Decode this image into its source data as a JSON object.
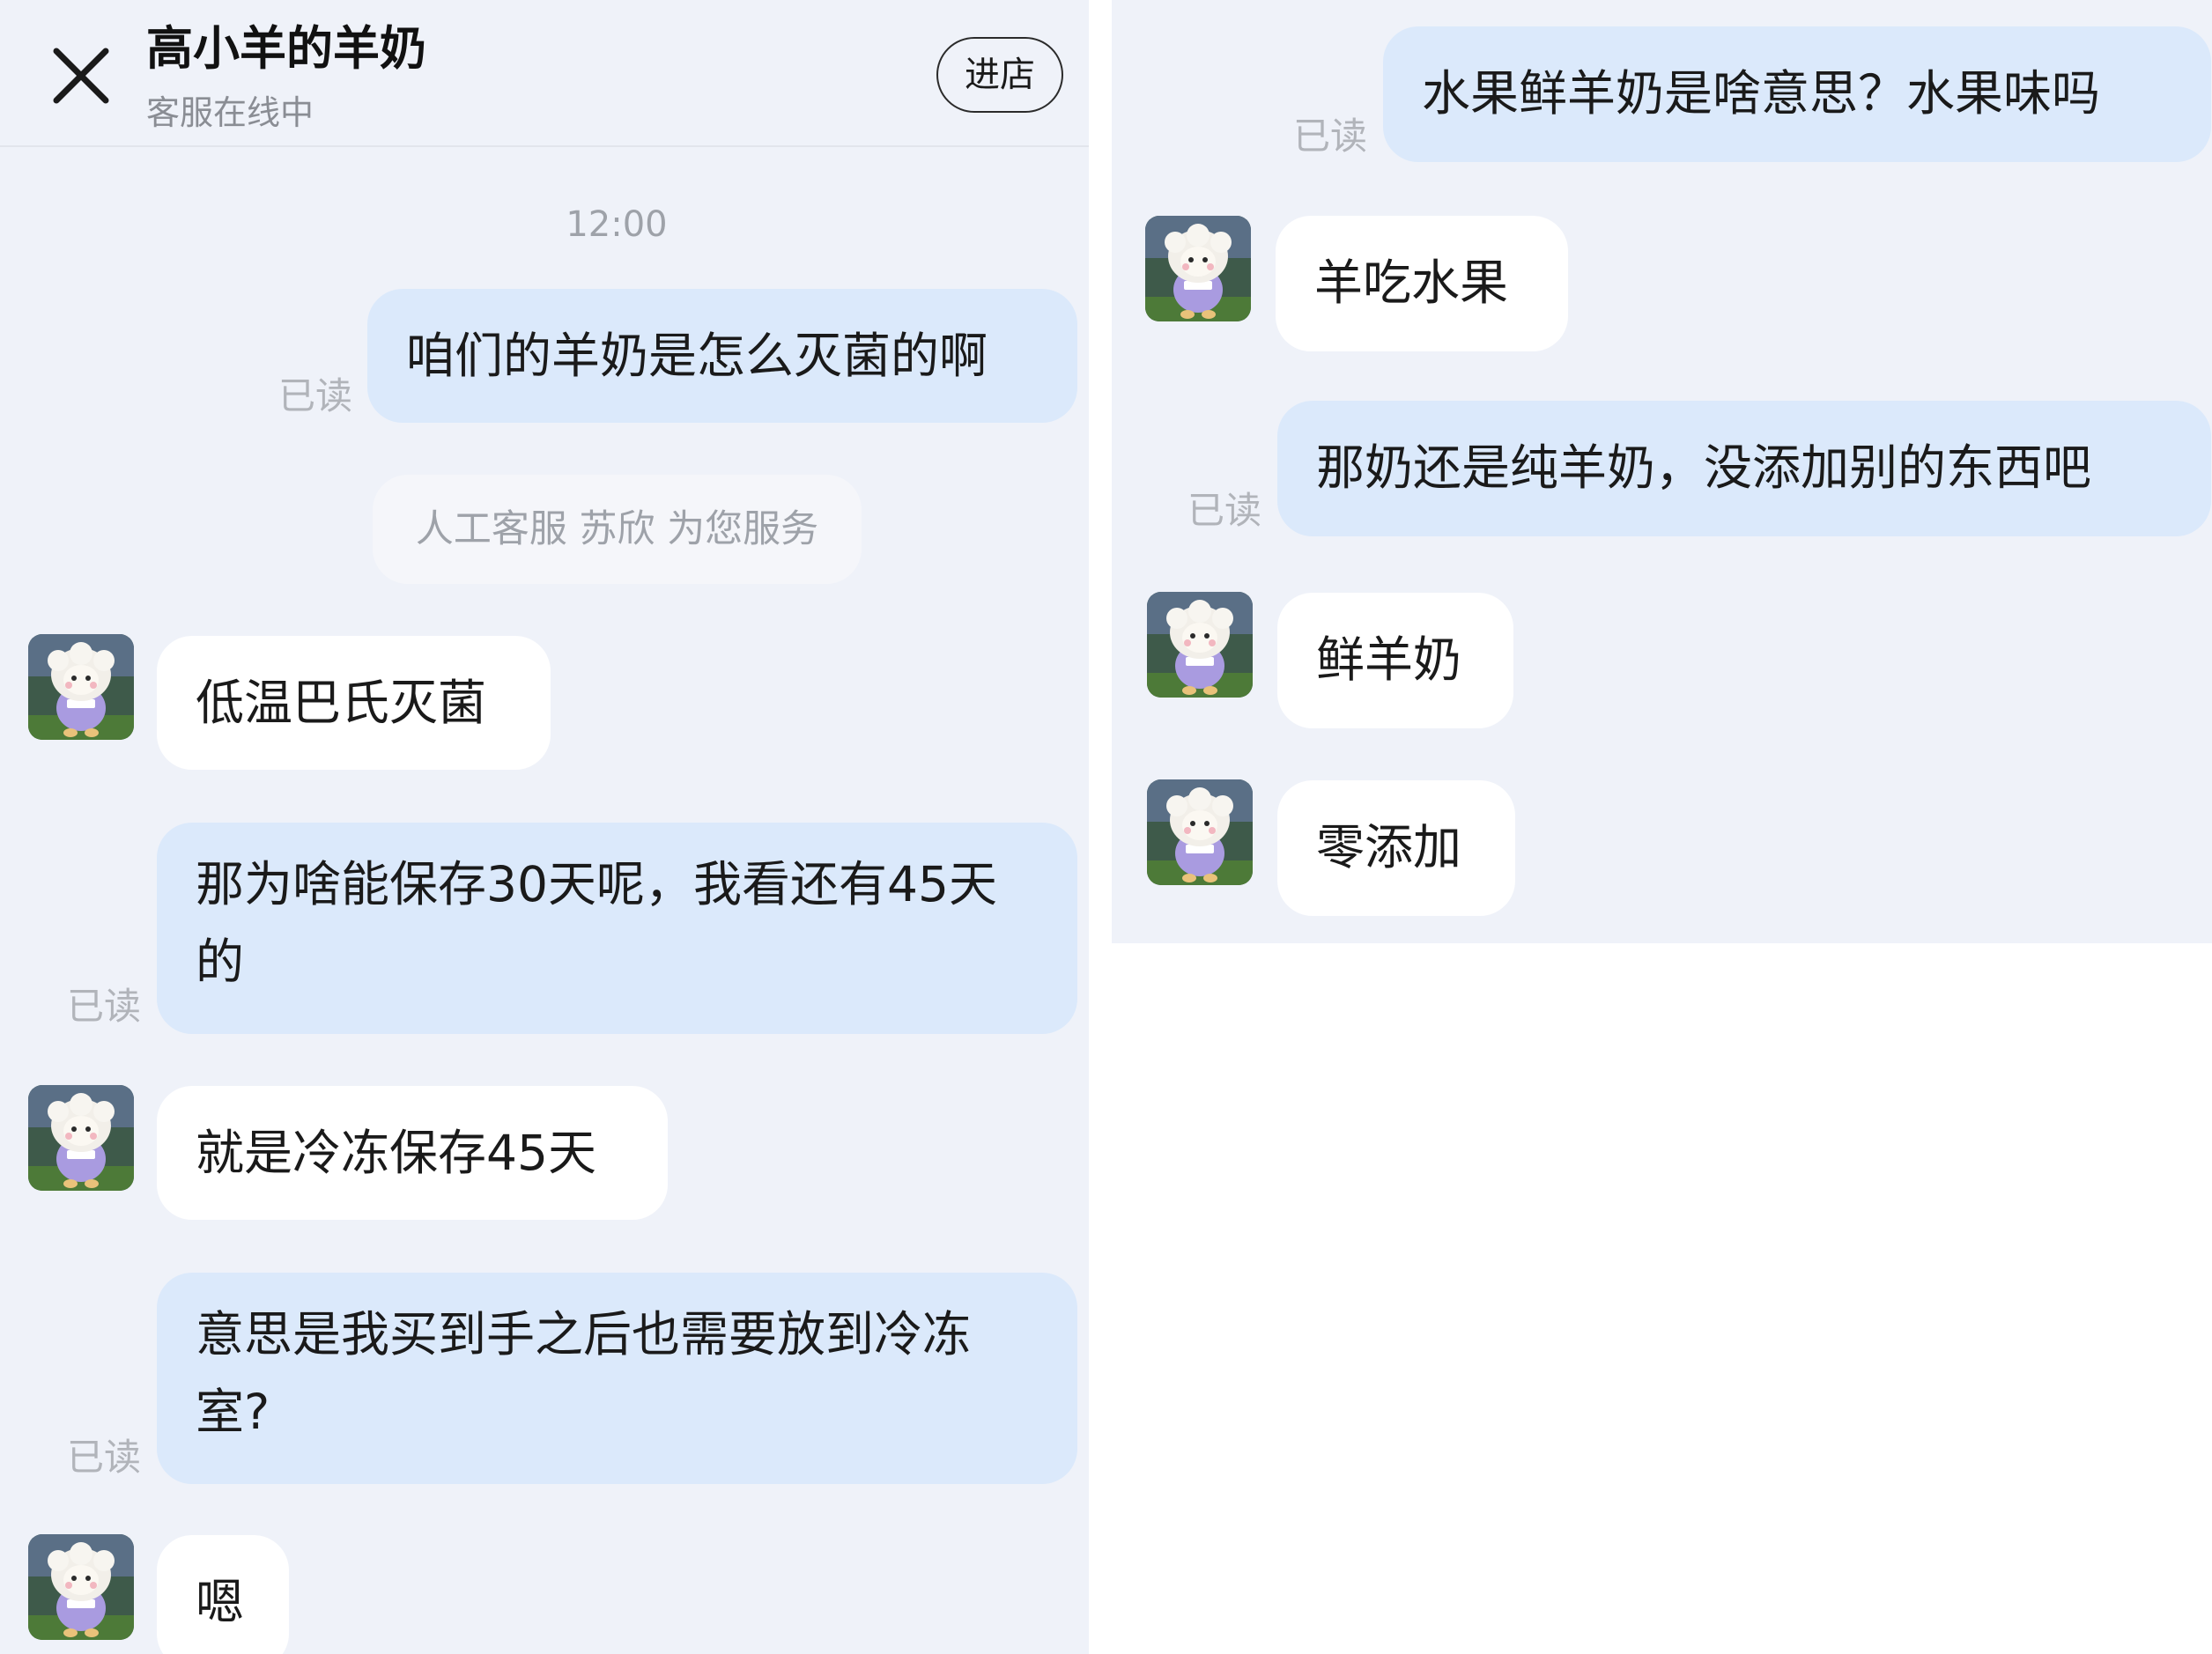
{
  "header": {
    "title": "高小羊的羊奶",
    "status": "客服在线中",
    "enter_shop_label": "进店"
  },
  "icons": {
    "close": "close-icon",
    "avatar": "agent-avatar-sheep"
  },
  "colors": {
    "background": "#eff2f9",
    "user_bubble": "#dbe9fb",
    "agent_bubble": "#ffffff",
    "read_mark": "#b1b4ba"
  },
  "left_chat": {
    "timestamp": "12:00",
    "notice": "人工客服 苏欣 为您服务",
    "messages": [
      {
        "from": "user",
        "text": "咱们的羊奶是怎么灭菌的啊",
        "read": "已读"
      },
      {
        "from": "agent",
        "text": "低温巴氏灭菌"
      },
      {
        "from": "user",
        "text": "那为啥能保存30天呢，我看还有45天的",
        "read": "已读"
      },
      {
        "from": "agent",
        "text": "就是冷冻保存45天"
      },
      {
        "from": "user",
        "text": "意思是我买到手之后也需要放到冷冻室?",
        "read": "已读"
      },
      {
        "from": "agent",
        "text": "嗯"
      }
    ]
  },
  "right_chat": {
    "messages": [
      {
        "from": "user",
        "text": "水果鲜羊奶是啥意思？水果味吗",
        "read": "已读"
      },
      {
        "from": "agent",
        "text": "羊吃水果"
      },
      {
        "from": "user",
        "text": "那奶还是纯羊奶，没添加别的东西吧",
        "read": "已读"
      },
      {
        "from": "agent",
        "text": "鲜羊奶"
      },
      {
        "from": "agent",
        "text": "零添加"
      }
    ]
  }
}
